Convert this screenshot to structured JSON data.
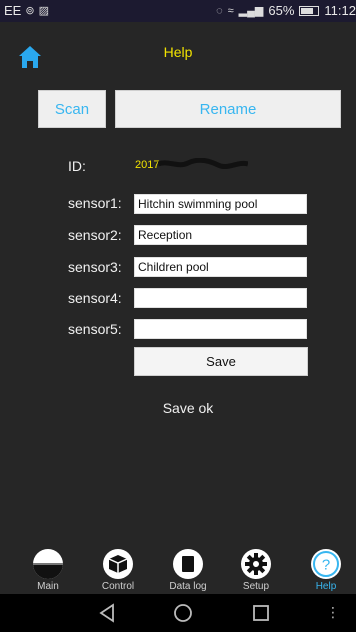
{
  "status_bar": {
    "carrier": "EE",
    "battery": "65%",
    "time": "11:12"
  },
  "header": {
    "title": "Help"
  },
  "toolbar": {
    "scan_label": "Scan",
    "rename_label": "Rename"
  },
  "device": {
    "id_label": "ID:",
    "id_value": "2017"
  },
  "sensors": [
    {
      "label": "sensor1:",
      "value": "Hitchin swimming pool"
    },
    {
      "label": "sensor2:",
      "value": "Reception"
    },
    {
      "label": "sensor3:",
      "value": "Children pool"
    },
    {
      "label": "sensor4:",
      "value": ""
    },
    {
      "label": "sensor5:",
      "value": ""
    }
  ],
  "save_label": "Save",
  "status_message": "Save ok",
  "nav": [
    {
      "label": "Main",
      "icon": "half-circle-icon"
    },
    {
      "label": "Control",
      "icon": "box-icon"
    },
    {
      "label": "Data log",
      "icon": "document-icon"
    },
    {
      "label": "Setup",
      "icon": "gear-icon"
    },
    {
      "label": "Help",
      "icon": "help-icon"
    }
  ],
  "colors": {
    "accent_yellow": "#f2e300",
    "accent_blue": "#38b6f0",
    "background": "#262626"
  }
}
